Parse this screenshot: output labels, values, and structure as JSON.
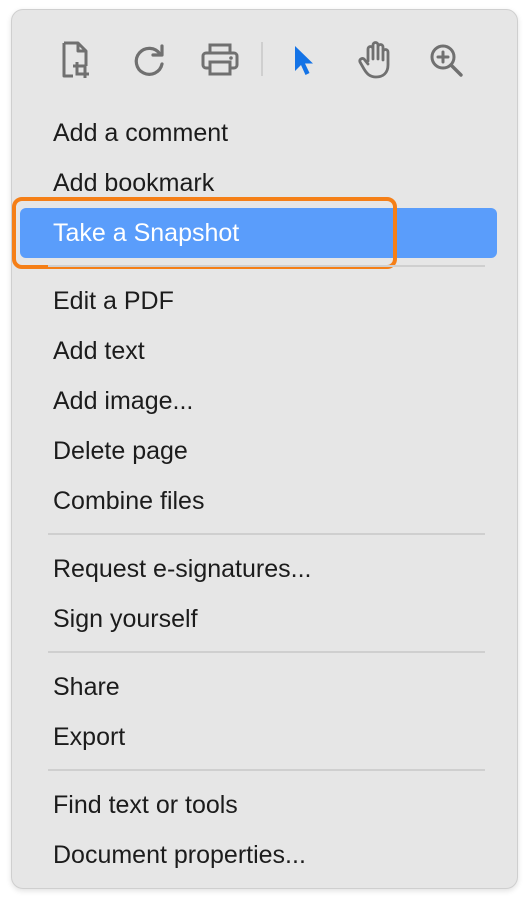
{
  "toolbar": {
    "tools": [
      {
        "name": "crop-page-icon",
        "label": "Crop pages"
      },
      {
        "name": "rotate-icon",
        "label": "Rotate"
      },
      {
        "name": "print-icon",
        "label": "Print"
      },
      {
        "name": "select-cursor-icon",
        "label": "Select",
        "active": true
      },
      {
        "name": "hand-tool-icon",
        "label": "Hand tool"
      },
      {
        "name": "zoom-in-icon",
        "label": "Zoom in"
      }
    ],
    "icon_color": "#707070",
    "active_color": "#1473e6"
  },
  "menu": {
    "groups": [
      {
        "items": [
          "Add a comment",
          "Add bookmark",
          "Take a Snapshot"
        ]
      },
      {
        "items": [
          "Edit a PDF",
          "Add text",
          "Add image...",
          "Delete page",
          "Combine files"
        ]
      },
      {
        "items": [
          "Request e-signatures...",
          "Sign yourself"
        ]
      },
      {
        "items": [
          "Share",
          "Export"
        ]
      },
      {
        "items": [
          "Find text or tools",
          "Document properties..."
        ]
      }
    ],
    "selected_item": "Take a Snapshot",
    "highlight_color": "#5a9dfb",
    "focus_outline_color": "#f57f17"
  }
}
